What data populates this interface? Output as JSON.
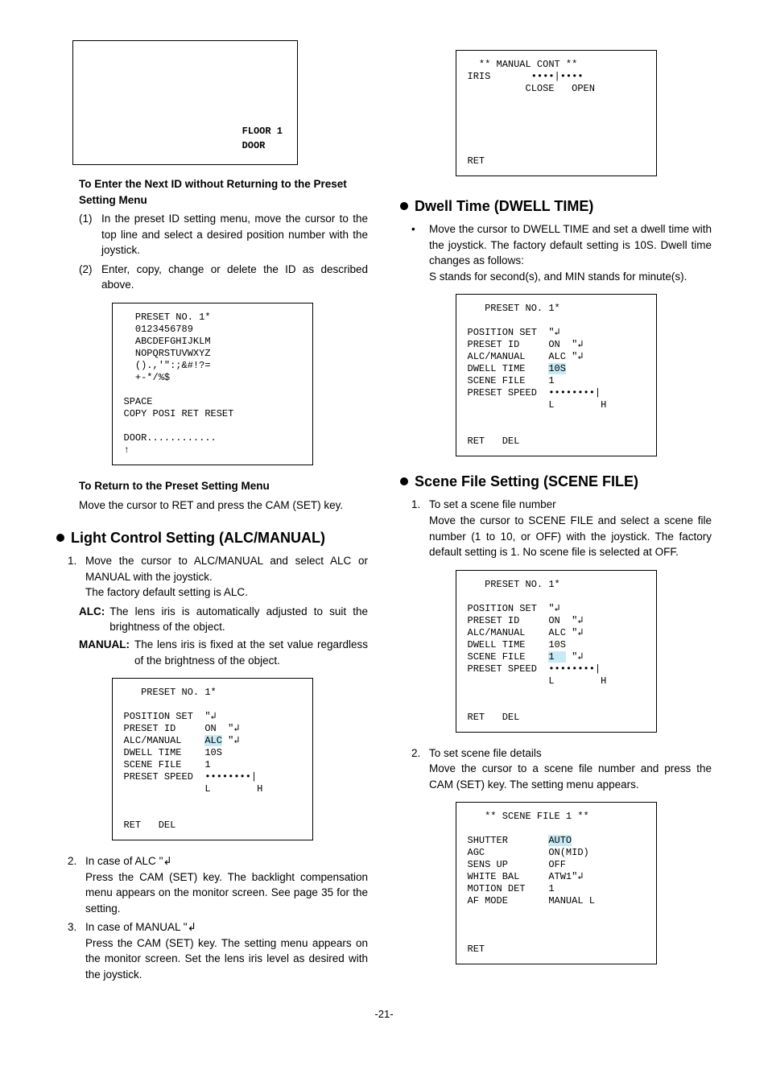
{
  "left": {
    "screen_floor": "FLOOR 1\nDOOR",
    "enter_next_head": "To Enter the Next ID without Returning to the Preset Setting Menu",
    "enter_next_1_n": "(1)",
    "enter_next_1_t": "In the preset ID setting menu, move the cursor to the top line and select a desired position number with the joystick.",
    "enter_next_2_n": "(2)",
    "enter_next_2_t": "Enter, copy, change or delete the ID as described above.",
    "id_screen": "  PRESET NO. 1*\n  0123456789\n  ABCDEFGHIJKLM\n  NOPQRSTUVWXYZ\n  ().,'\":;&#!?=\n  +-*/%$\n\nSPACE\nCOPY POSI RET RESET\n\nDOOR............\n↑",
    "return_head": "To Return to the Preset Setting Menu",
    "return_t": "Move the cursor to RET and press the CAM (SET) key.",
    "alc_head": "Light Control Setting (ALC/MANUAL)",
    "alc_1_n": "1.",
    "alc_1_t": "Move the cursor to ALC/MANUAL and select ALC or MANUAL with the joystick.",
    "alc_1_f": "The factory default setting is ALC.",
    "alc_def_k": "ALC:",
    "alc_def_v": "The lens iris is automatically adjusted to suit the brightness of the object.",
    "man_def_k": "MANUAL:",
    "man_def_v": "The lens iris is fixed at the set value regardless of the brightness of the object.",
    "preset_screen_alc_title": "   PRESET NO. 1*",
    "preset_screen_alc_body": "\nPOSITION SET  \"↲\nPRESET ID     ON  \"↲\nALC/MANUAL    ALC \"↲\nDWELL TIME    10S\nSCENE FILE    1\nPRESET SPEED  ••••••••|\n              L        H\n\n\nRET   DEL",
    "alc_2_n": "2.",
    "alc_2_t_a": "In case of ALC ",
    "alc_2_sym": "\"↲",
    "alc_2_body": "Press the CAM (SET) key. The backlight compensation menu appears on the monitor screen. See page 35 for the setting.",
    "alc_3_n": "3.",
    "alc_3_t_a": "In case of MANUAL ",
    "alc_3_sym": "\"↲",
    "alc_3_body": "Press the CAM (SET) key. The setting menu appears on the monitor screen. Set the lens iris level as desired with the joystick."
  },
  "right": {
    "manual_cont_title": "  ** MANUAL CONT **",
    "manual_cont_body": "\nIRIS       ••••|••••\n          CLOSE   OPEN\n\n\n\n\n\nRET",
    "dwell_head": "Dwell Time (DWELL TIME)",
    "dwell_bullet": "•",
    "dwell_t": "Move the cursor to DWELL TIME and set a dwell time with the joystick. The factory default setting is 10S. Dwell time changes as follows:",
    "dwell_t2": "S stands for second(s), and MIN stands for minute(s).",
    "preset_screen_dwell_title": "   PRESET NO. 1*",
    "preset_screen_dwell_body": "\nPOSITION SET  \"↲\nPRESET ID     ON  \"↲\nALC/MANUAL    ALC \"↲\nDWELL TIME    10S\nSCENE FILE    1\nPRESET SPEED  ••••••••|\n              L        H\n\n\nRET   DEL",
    "scene_head": "Scene File Setting (SCENE FILE)",
    "scene_1_n": "1.",
    "scene_1_t": "To set a scene file number",
    "scene_1_body": "Move the cursor to SCENE FILE and select a scene file number (1 to 10, or OFF) with the joystick. The factory default setting is 1. No scene file is selected at OFF.",
    "preset_screen_scene_title": "   PRESET NO. 1*",
    "preset_screen_scene_body": "\nPOSITION SET  \"↲\nPRESET ID     ON  \"↲\nALC/MANUAL    ALC \"↲\nDWELL TIME    10S\nSCENE FILE    1   \"↲\nPRESET SPEED  ••••••••|\n              L        H\n\n\nRET   DEL",
    "scene_2_n": "2.",
    "scene_2_t": "To set scene file details",
    "scene_2_body": "Move the cursor to a scene file number and press the CAM (SET) key. The setting menu appears.",
    "scenefile_screen_title": "   ** SCENE FILE 1 **",
    "scenefile_screen_body": "\nSHUTTER       AUTO\nAGC           ON(MID)\nSENS UP       OFF\nWHITE BAL     ATW1\"↲\nMOTION DET    1\nAF MODE       MANUAL L\n\n\n\nRET"
  },
  "page_num": "-21-"
}
